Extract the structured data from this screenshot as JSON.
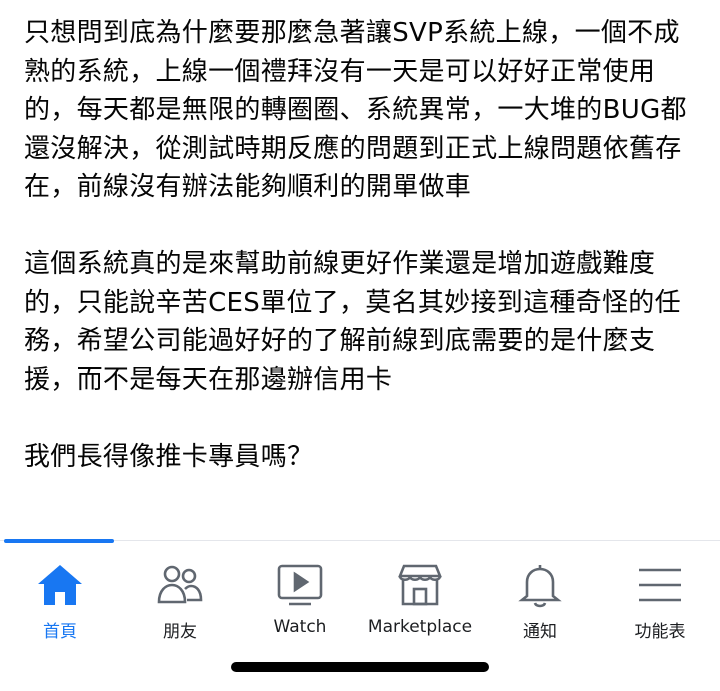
{
  "post": {
    "paragraphs": [
      "只想問到底為什麼要那麼急著讓SVP系統上線，一個不成熟的系統，上線一個禮拜沒有一天是可以好好正常使用的，每天都是無限的轉圈圈、系統異常，一大堆的BUG都還沒解決，從測試時期反應的問題到正式上線問題依舊存在，前線沒有辦法能夠順利的開單做車",
      "這個系統真的是來幫助前線更好作業還是增加遊戲難度的，只能說辛苦CES單位了，莫名其妙接到這種奇怪的任務，希望公司能過好好的了解前線到底需要的是什麼支援，而不是每天在那邊辦信用卡",
      "我們長得像推卡專員嗎？"
    ]
  },
  "tabbar": {
    "accent_color": "#1877f2",
    "icon_color": "#606770",
    "tabs": [
      {
        "label": "首頁",
        "icon": "home-icon",
        "active": true
      },
      {
        "label": "朋友",
        "icon": "friends-icon",
        "active": false
      },
      {
        "label": "Watch",
        "icon": "watch-icon",
        "active": false
      },
      {
        "label": "Marketplace",
        "icon": "marketplace-icon",
        "active": false
      },
      {
        "label": "通知",
        "icon": "bell-icon",
        "active": false
      },
      {
        "label": "功能表",
        "icon": "menu-icon",
        "active": false
      }
    ]
  }
}
